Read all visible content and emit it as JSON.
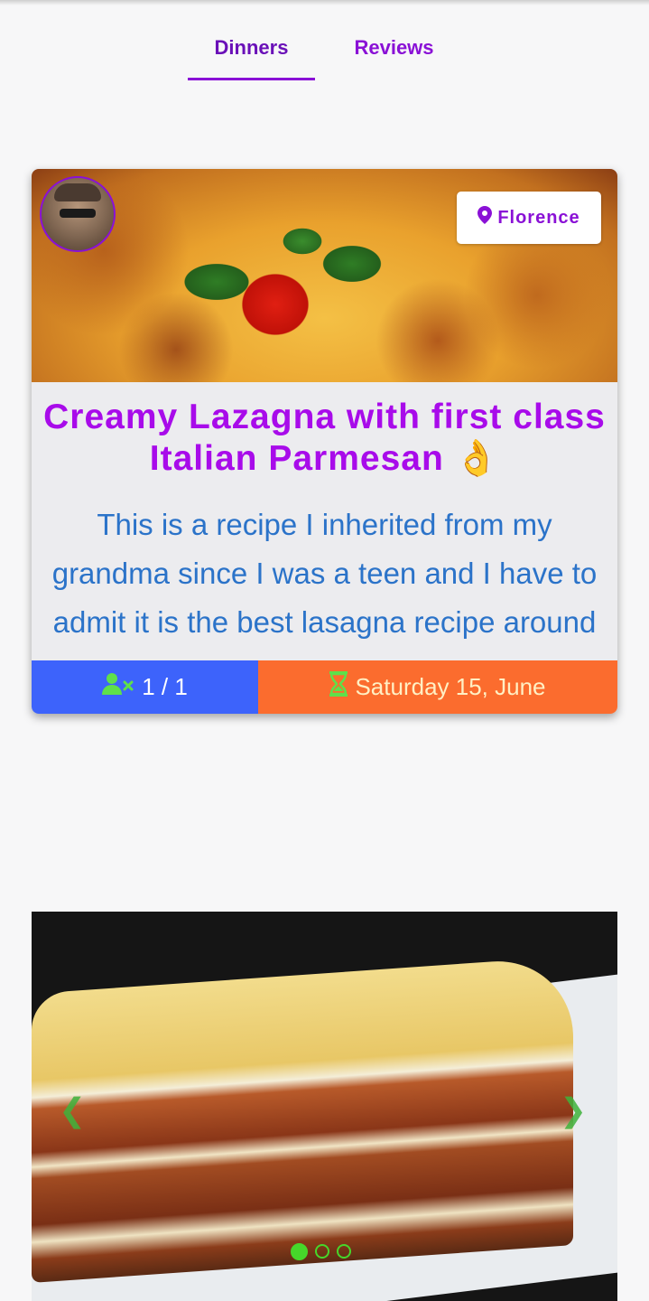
{
  "tabs": [
    {
      "label": "Dinners",
      "active": true
    },
    {
      "label": "Reviews",
      "active": false
    }
  ],
  "card": {
    "location": "Florence",
    "title": "Creamy Lazagna with first class Italian Parmesan 👌",
    "description_lines": [
      "This is a recipe I inherited from my",
      "grandma since I was a teen and I have to",
      "admit it is the best lasagna recipe around"
    ],
    "guests": "1 / 1",
    "date": "Saturday 15, June",
    "colors": {
      "title": "#a80bea",
      "description": "#2b73c9",
      "guests_bg": "#3d63fb",
      "date_bg": "#fb6c2e",
      "accent": "#8a11d6"
    },
    "icons": {
      "location": "map-pin-icon",
      "guests": "user-times-icon",
      "date": "hourglass-icon"
    }
  },
  "carousel": {
    "slide_count": 3,
    "active_index": 0,
    "icons": {
      "prev": "chevron-left-icon",
      "next": "chevron-right-icon"
    },
    "dot_color": "#46d72a"
  }
}
